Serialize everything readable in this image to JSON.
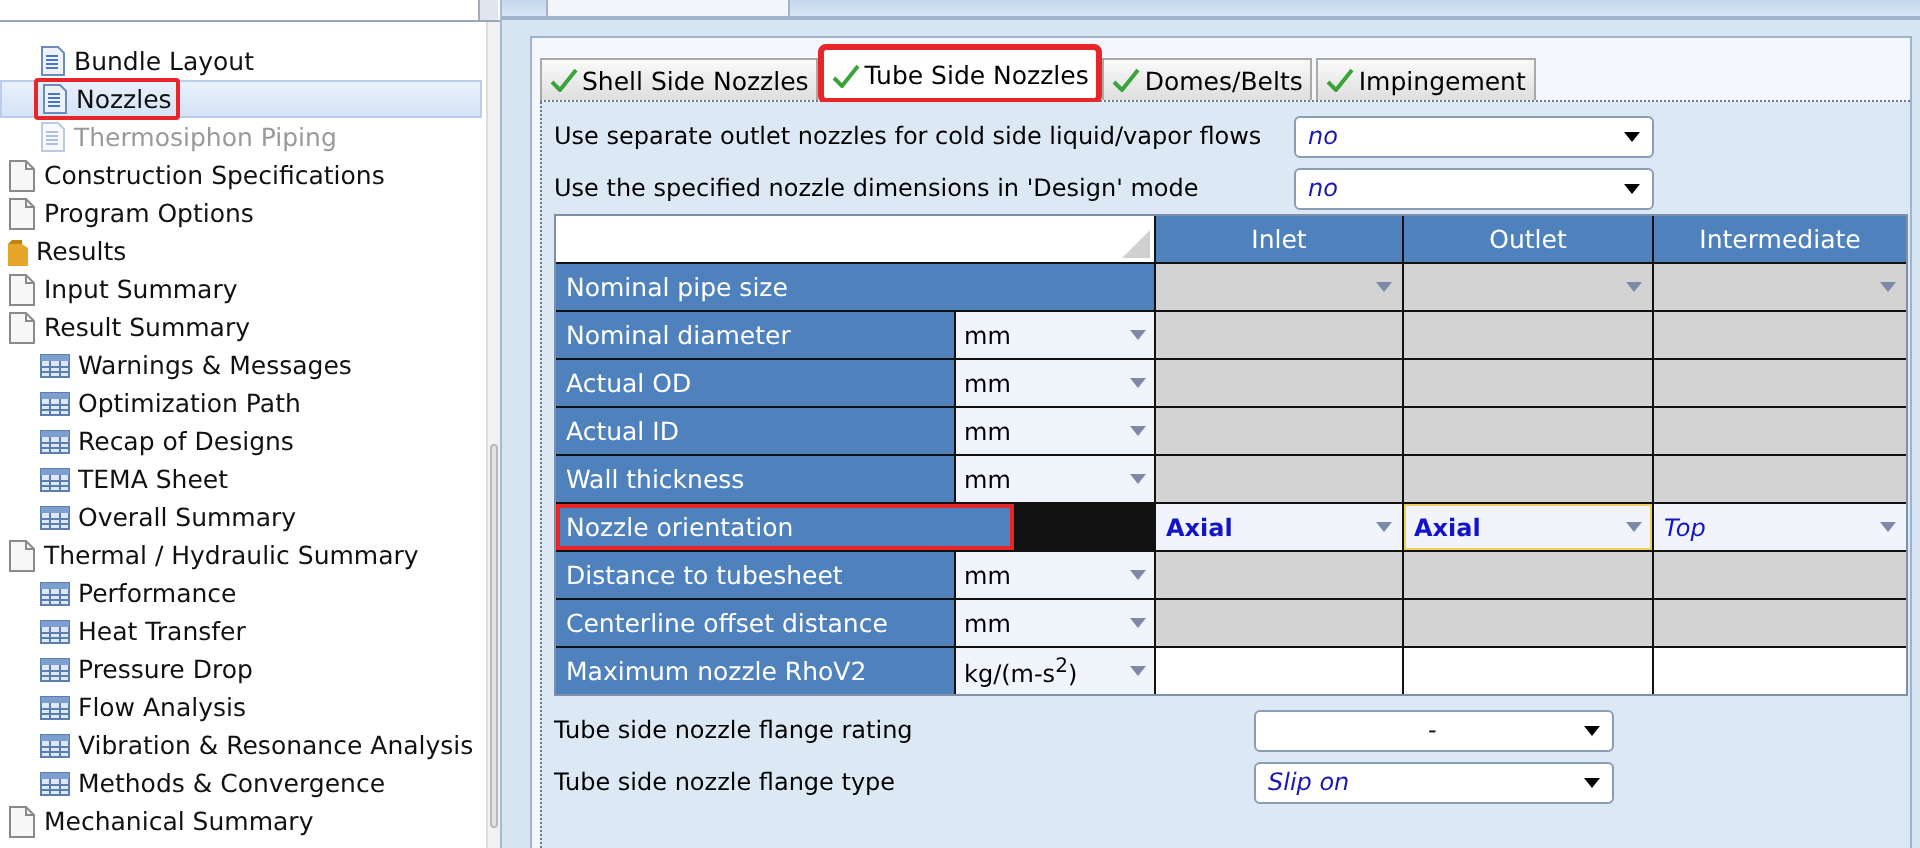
{
  "tree": [
    {
      "children": [
        {
          "children": [
            {
              "label": "Bundle Layout",
              "kind": "page",
              "selected": false,
              "disabled": false,
              "highlighted": false
            },
            {
              "label": "Nozzles",
              "kind": "page",
              "selected": true,
              "disabled": false,
              "highlighted": true
            },
            {
              "label": "Thermosiphon Piping",
              "kind": "page",
              "selected": false,
              "disabled": true,
              "highlighted": false
            }
          ]
        },
        {
          "label": "Construction Specifications",
          "kind": "form",
          "selected": false,
          "disabled": false,
          "highlighted": false
        },
        {
          "label": "Program Options",
          "kind": "form",
          "selected": false,
          "disabled": false,
          "highlighted": false
        }
      ]
    },
    {
      "label": "Results",
      "kind": "folder",
      "selected": false,
      "disabled": false,
      "highlighted": false,
      "children": [
        {
          "label": "Input Summary",
          "kind": "form",
          "selected": false,
          "disabled": false,
          "highlighted": false
        },
        {
          "label": "Result Summary",
          "kind": "form",
          "selected": false,
          "disabled": false,
          "highlighted": false,
          "children": [
            {
              "label": "Warnings & Messages",
              "kind": "table",
              "selected": false,
              "disabled": false,
              "highlighted": false
            },
            {
              "label": "Optimization Path",
              "kind": "table",
              "selected": false,
              "disabled": false,
              "highlighted": false
            },
            {
              "label": "Recap of Designs",
              "kind": "table",
              "selected": false,
              "disabled": false,
              "highlighted": false
            },
            {
              "label": "TEMA Sheet",
              "kind": "table",
              "selected": false,
              "disabled": false,
              "highlighted": false
            },
            {
              "label": "Overall Summary",
              "kind": "table",
              "selected": false,
              "disabled": false,
              "highlighted": false
            }
          ]
        },
        {
          "label": "Thermal / Hydraulic Summary",
          "kind": "form",
          "selected": false,
          "disabled": false,
          "highlighted": false,
          "children": [
            {
              "label": "Performance",
              "kind": "table",
              "selected": false,
              "disabled": false,
              "highlighted": false
            },
            {
              "label": "Heat Transfer",
              "kind": "table",
              "selected": false,
              "disabled": false,
              "highlighted": false
            },
            {
              "label": "Pressure Drop",
              "kind": "table",
              "selected": false,
              "disabled": false,
              "highlighted": false
            },
            {
              "label": "Flow Analysis",
              "kind": "table",
              "selected": false,
              "disabled": false,
              "highlighted": false
            },
            {
              "label": "Vibration & Resonance Analysis",
              "kind": "table",
              "selected": false,
              "disabled": false,
              "highlighted": false
            },
            {
              "label": "Methods & Convergence",
              "kind": "table",
              "selected": false,
              "disabled": false,
              "highlighted": false
            }
          ]
        },
        {
          "label": "Mechanical Summary",
          "kind": "form",
          "selected": false,
          "disabled": false,
          "highlighted": false
        }
      ]
    }
  ],
  "tabs": [
    {
      "label": "Shell Side Nozzles",
      "selected": false,
      "highlighted": false
    },
    {
      "label": "Tube Side Nozzles",
      "selected": true,
      "highlighted": true
    },
    {
      "label": "Domes/Belts",
      "selected": false,
      "highlighted": false
    },
    {
      "label": "Impingement",
      "selected": false,
      "highlighted": false
    }
  ],
  "options": [
    {
      "label": "Use separate outlet nozzles for cold side liquid/vapor flows",
      "value": "no",
      "default": true
    },
    {
      "label": "Use the specified nozzle dimensions  in 'Design' mode",
      "value": "no",
      "default": true
    }
  ],
  "grid": {
    "columns": [
      "Inlet",
      "Outlet",
      "Intermediate"
    ],
    "rows": [
      {
        "label": "Nominal pipe size",
        "highlighted": false,
        "cells": [
          {
            "kind": "locked-select"
          },
          {
            "kind": "locked-select"
          },
          {
            "kind": "locked-select"
          }
        ]
      },
      {
        "label": "Nominal diameter",
        "unit": "mm",
        "highlighted": false,
        "cells": [
          {
            "kind": "locked"
          },
          {
            "kind": "locked"
          },
          {
            "kind": "locked"
          }
        ]
      },
      {
        "label": "Actual OD",
        "unit": "mm",
        "highlighted": false,
        "cells": [
          {
            "kind": "locked"
          },
          {
            "kind": "locked"
          },
          {
            "kind": "locked"
          }
        ]
      },
      {
        "label": "Actual ID",
        "unit": "mm",
        "highlighted": false,
        "cells": [
          {
            "kind": "locked"
          },
          {
            "kind": "locked"
          },
          {
            "kind": "locked"
          }
        ]
      },
      {
        "label": "Wall thickness",
        "unit": "mm",
        "highlighted": false,
        "cells": [
          {
            "kind": "locked"
          },
          {
            "kind": "locked"
          },
          {
            "kind": "locked"
          }
        ]
      },
      {
        "label": "Nozzle orientation",
        "highlighted": true,
        "cells": [
          {
            "kind": "select",
            "value": "Axial",
            "default": false,
            "focused": false
          },
          {
            "kind": "select",
            "value": "Axial",
            "default": false,
            "focused": true
          },
          {
            "kind": "select",
            "value": "Top",
            "default": true,
            "focused": false
          }
        ]
      },
      {
        "label": "Distance to tubesheet",
        "unit": "mm",
        "highlighted": false,
        "cells": [
          {
            "kind": "locked"
          },
          {
            "kind": "locked"
          },
          {
            "kind": "locked"
          }
        ]
      },
      {
        "label": "Centerline offset distance",
        "unit": "mm",
        "highlighted": false,
        "cells": [
          {
            "kind": "locked"
          },
          {
            "kind": "locked"
          },
          {
            "kind": "locked"
          }
        ]
      },
      {
        "label": "Maximum nozzle RhoV2",
        "unit": "kg/(m-s$^{2}$)",
        "highlighted": false,
        "cells": [
          {
            "kind": "blank"
          },
          {
            "kind": "blank"
          },
          {
            "kind": "blank"
          }
        ]
      }
    ]
  },
  "flange_options": [
    {
      "label": "Tube side nozzle flange rating",
      "value": "-",
      "default": false
    },
    {
      "label": "Tube side nozzle flange type",
      "value": "Slip on",
      "default": true
    }
  ]
}
